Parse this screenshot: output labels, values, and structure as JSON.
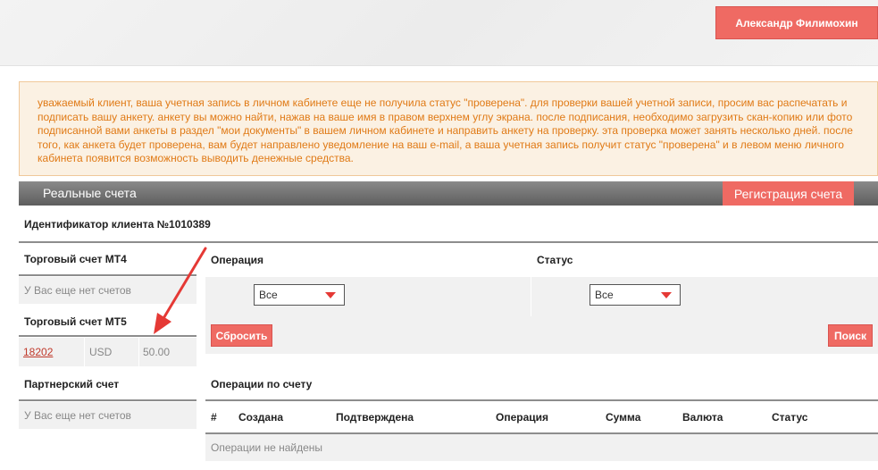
{
  "header": {
    "user_name": "Александр Филимохин"
  },
  "notice": {
    "text": "уважаемый клиент, ваша учетная запись в личном кабинете еще не получила статус \"проверена\". для проверки вашей учетной записи, просим вас распечатать и подписать вашу анкету. анкету вы можно найти, нажав на ваше имя в правом верхнем углу экрана. после подписания, необходимо загрузить скан-копию или фото подписанной вами анкеты в раздел \"мои документы\" в вашем личном кабинете и направить анкету на проверку. эта проверка может занять несколько дней. после того, как анкета будет проверена, вам будет направлено уведомление на ваш e-mail, а ваша учетная запись получит статус \"проверена\" и в левом меню личного кабинета появится возможность выводить денежные средства."
  },
  "accounts_bar": {
    "title": "Реальные счета",
    "register_label": "Регистрация счета"
  },
  "client": {
    "id_label": "Идентификатор клиента №1010389"
  },
  "left_panel": {
    "mt4_title": "Торговый счет MT4",
    "mt4_empty": "У Вас еще нет счетов",
    "mt5_title": "Торговый счет MT5",
    "mt5_account": {
      "number": "18202",
      "currency": "USD",
      "balance": "50.00"
    },
    "partner_title": "Партнерский счет",
    "partner_empty": "У Вас еще нет счетов"
  },
  "filters": {
    "operation_label": "Операция",
    "status_label": "Статус",
    "operation_value": "Все",
    "status_value": "Все",
    "reset_label": "Сбросить",
    "search_label": "Поиск"
  },
  "operations": {
    "title": "Операции по счету",
    "columns": [
      "#",
      "Создана",
      "Подтверждена",
      "Операция",
      "Сумма",
      "Валюта",
      "Статус"
    ],
    "empty_text": "Операции не найдены"
  },
  "colors": {
    "accent": "#ef6a63",
    "notice_text": "#e07a16",
    "notice_bg": "#fbf1e3",
    "annotation_arrow": "#e53935"
  }
}
